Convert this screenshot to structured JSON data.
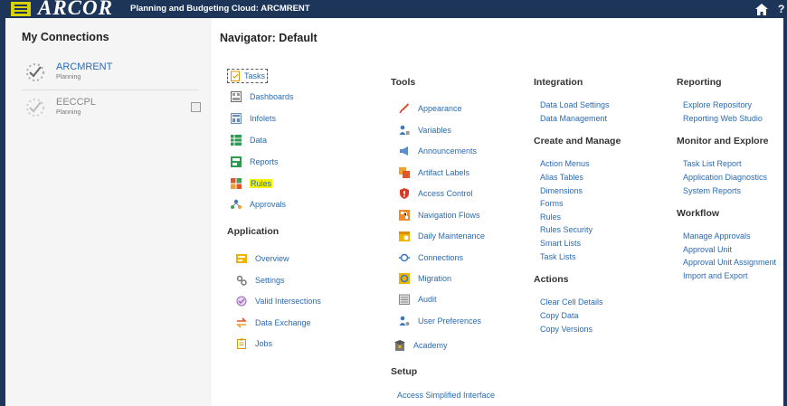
{
  "topbar": {
    "logo": "ARCOR",
    "title": "Planning and Budgeting Cloud: ARCMRENT",
    "help_label": "?"
  },
  "connections": {
    "title": "My Connections",
    "items": [
      {
        "name": "ARCMRENT",
        "type": "Planning"
      },
      {
        "name": "EECCPL",
        "type": "Planning"
      }
    ]
  },
  "navigator": {
    "title": "Navigator: Default",
    "col1": {
      "items": [
        "Tasks",
        "Dashboards",
        "Infolets",
        "Data",
        "Reports",
        "Rules",
        "Approvals"
      ],
      "application_head": "Application",
      "application_items": [
        "Overview",
        "Settings",
        "Valid Intersections",
        "Data Exchange",
        "Jobs"
      ]
    },
    "tools": {
      "head": "Tools",
      "items": [
        "Appearance",
        "Variables",
        "Announcements",
        "Artifact Labels",
        "Access Control",
        "Navigation Flows",
        "Daily Maintenance",
        "Connections",
        "Migration",
        "Audit",
        "User Preferences"
      ],
      "academy": "Academy",
      "setup_head": "Setup",
      "setup_items": [
        "Access Simplified Interface"
      ]
    },
    "integration": {
      "head": "Integration",
      "items": [
        "Data Load Settings",
        "Data Management"
      ],
      "create_head": "Create and Manage",
      "create_items": [
        "Action Menus",
        "Alias Tables",
        "Dimensions",
        "Forms",
        "Rules",
        "Rules Security",
        "Smart Lists",
        "Task Lists"
      ],
      "actions_head": "Actions",
      "actions_items": [
        "Clear Cell Details",
        "Copy Data",
        "Copy Versions"
      ]
    },
    "reporting": {
      "head": "Reporting",
      "items": [
        "Explore Repository",
        "Reporting Web Studio"
      ],
      "monitor_head": "Monitor and Explore",
      "monitor_items": [
        "Task List Report",
        "Application Diagnostics",
        "System Reports"
      ],
      "workflow_head": "Workflow",
      "workflow_items": [
        "Manage Approvals",
        "Approval Unit",
        "Approval Unit Assignment",
        "Import and Export"
      ]
    }
  },
  "colors": {
    "topbar": "#1c3559",
    "hamburger": "#d8d200",
    "link": "#2a6ab1",
    "highlight": "#f4f300"
  }
}
